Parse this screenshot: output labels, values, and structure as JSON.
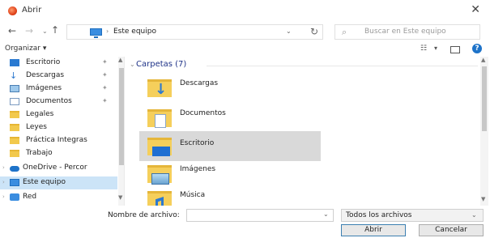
{
  "window": {
    "title": "Abrir",
    "close_glyph": "✕"
  },
  "nav": {
    "back": "←",
    "forward": "→",
    "recent": "⌄",
    "up": "↑",
    "address_sep": "›",
    "address": "Este equipo",
    "address_chevron": "⌄",
    "refresh": "↻",
    "search_icon": "⌕",
    "search_placeholder": "Buscar en Este equipo"
  },
  "toolbar": {
    "organize": "Organizar ▾",
    "view_glyph": "☷",
    "view_drop": "▾",
    "help": "?"
  },
  "sidebar": {
    "items": [
      {
        "label": "Escritorio",
        "icon": "desktop-icon",
        "pinned": true
      },
      {
        "label": "Descargas",
        "icon": "download-icon",
        "pinned": true
      },
      {
        "label": "Imágenes",
        "icon": "images-icon",
        "pinned": true
      },
      {
        "label": "Documentos",
        "icon": "documents-icon",
        "pinned": true
      },
      {
        "label": "Legales",
        "icon": "folder-icon",
        "pinned": false
      },
      {
        "label": "Leyes",
        "icon": "folder-icon",
        "pinned": false
      },
      {
        "label": "Práctica Integras",
        "icon": "folder-icon",
        "pinned": false
      },
      {
        "label": "Trabajo",
        "icon": "folder-icon",
        "pinned": false
      },
      {
        "label": "OneDrive - Percor",
        "icon": "onedrive-icon",
        "pinned": false
      },
      {
        "label": "Este equipo",
        "icon": "this-pc-icon",
        "pinned": false,
        "selected": true
      },
      {
        "label": "Red",
        "icon": "network-icon",
        "pinned": false
      }
    ],
    "pin_glyph": "✦",
    "expand_glyph": "›"
  },
  "content": {
    "group": "Carpetas (7)",
    "group_chevron": "⌄",
    "items": [
      {
        "label": "Descargas",
        "icon": "downloads-folder-icon",
        "selected": false
      },
      {
        "label": "Documentos",
        "icon": "documents-folder-icon",
        "selected": false
      },
      {
        "label": "Escritorio",
        "icon": "desktop-folder-icon",
        "selected": true
      },
      {
        "label": "Imágenes",
        "icon": "images-folder-icon",
        "selected": false
      },
      {
        "label": "Música",
        "icon": "music-folder-icon",
        "selected": false
      }
    ]
  },
  "scroll": {
    "up": "▲",
    "down": "▼"
  },
  "footer": {
    "filename_label": "Nombre de archivo:",
    "filename_value": "",
    "filetype": "Todos los archivos",
    "dropdown": "⌄",
    "open": "Abrir",
    "cancel": "Cancelar"
  }
}
